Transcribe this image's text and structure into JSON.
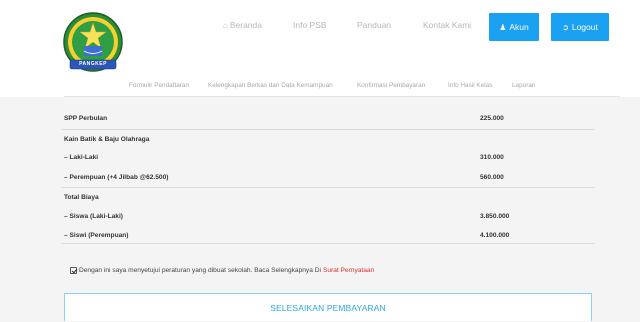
{
  "header": {
    "logo_text": "PANGKEP",
    "nav": [
      {
        "label": "Beranda",
        "icon": "home-icon"
      },
      {
        "label": "Info PSB",
        "icon": ""
      },
      {
        "label": "Panduan",
        "icon": ""
      },
      {
        "label": "Kontak Kami",
        "icon": ""
      }
    ],
    "akun_label": "Akun",
    "logout_label": "Logout",
    "button_color": "#1ba1f2"
  },
  "subnav": [
    "Formulir Pendaftaran",
    "Kelengkapan Berkas dan Data Kemampuan",
    "Konfirmasi Pembayaran",
    "Info Hasil Kelas",
    "Laporan"
  ],
  "fees": [
    {
      "label": "SPP Perbulan",
      "value": "225.000"
    },
    {
      "label": "Kain Batik & Baju Olahraga",
      "value": ""
    },
    {
      "label": "– Laki-Laki",
      "value": "310.000"
    },
    {
      "label": "– Perempuan (+4 Jilbab @62.500)",
      "value": "560.000"
    },
    {
      "label": "Total Biaya",
      "value": ""
    },
    {
      "label": "– Siswa (Laki-Laki)",
      "value": "3.850.000"
    },
    {
      "label": "– Siswi (Perempuan)",
      "value": "4.100.000"
    }
  ],
  "agreement": {
    "text": "Dengan ini saya menyetujui peraturan yang dibuat sekolah. Baca Selengkapnya Di",
    "link": "Surat Pernyataan",
    "checked": true
  },
  "finish_label": "SELESAIKAN PEMBAYARAN",
  "accent_color": "#29a5ec"
}
